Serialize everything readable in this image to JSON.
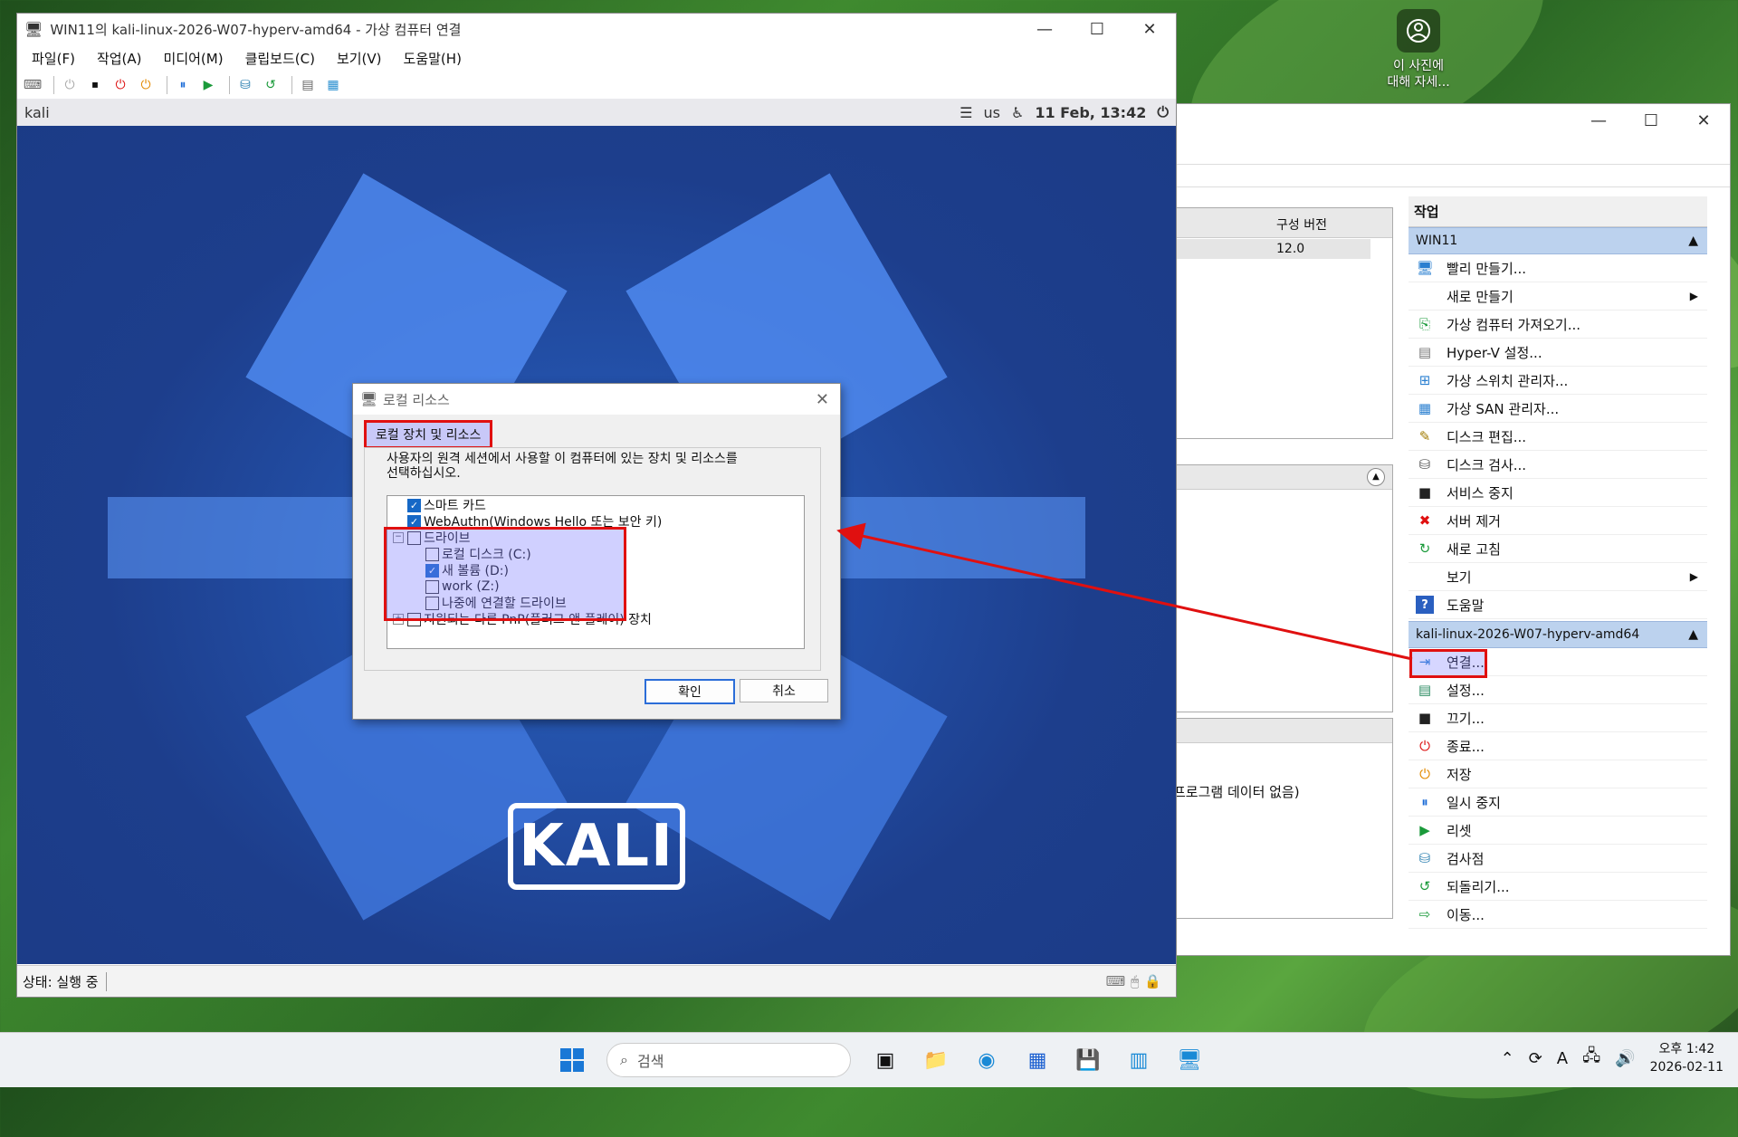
{
  "desktop": {
    "icon_label_line1": "이 사진에",
    "icon_label_line2": "대해 자세..."
  },
  "hyperv": {
    "col_header": "구성 버전",
    "col_value": "12.0",
    "no_data_text": "프로그램 데이터 없음)",
    "actions_title": "작업",
    "host_section": "WIN11",
    "host_items": [
      {
        "label": "빨리 만들기...",
        "icon": "quick-create-icon"
      },
      {
        "label": "새로 만들기",
        "icon": "none",
        "submenu": true
      },
      {
        "label": "가상 컴퓨터 가져오기...",
        "icon": "import-icon"
      },
      {
        "label": "Hyper-V 설정...",
        "icon": "settings-doc-icon"
      },
      {
        "label": "가상 스위치 관리자...",
        "icon": "switch-icon"
      },
      {
        "label": "가상 SAN 관리자...",
        "icon": "san-icon"
      },
      {
        "label": "디스크 편집...",
        "icon": "edit-disk-icon"
      },
      {
        "label": "디스크 검사...",
        "icon": "inspect-disk-icon"
      },
      {
        "label": "서비스 중지",
        "icon": "stop-service-icon"
      },
      {
        "label": "서버 제거",
        "icon": "remove-server-icon"
      },
      {
        "label": "새로 고침",
        "icon": "refresh-icon"
      },
      {
        "label": "보기",
        "icon": "none",
        "submenu": true
      },
      {
        "label": "도움말",
        "icon": "help-icon"
      }
    ],
    "vm_section": "kali-linux-2026-W07-hyperv-amd64",
    "vm_items": [
      {
        "label": "연결...",
        "icon": "connect-icon"
      },
      {
        "label": "설정...",
        "icon": "vm-settings-icon"
      },
      {
        "label": "끄기...",
        "icon": "turn-off-icon"
      },
      {
        "label": "종료...",
        "icon": "shutdown-icon"
      },
      {
        "label": "저장",
        "icon": "save-icon"
      },
      {
        "label": "일시 중지",
        "icon": "pause-icon"
      },
      {
        "label": "리셋",
        "icon": "reset-icon"
      },
      {
        "label": "검사점",
        "icon": "checkpoint-icon"
      },
      {
        "label": "되돌리기...",
        "icon": "revert-icon"
      },
      {
        "label": "이동...",
        "icon": "move-icon"
      }
    ]
  },
  "vmconnect": {
    "title": "WIN11의 kali-linux-2026-W07-hyperv-amd64 - 가상 컴퓨터 연결",
    "menu": [
      "파일(F)",
      "작업(A)",
      "미디어(M)",
      "클립보드(C)",
      "보기(V)",
      "도움말(H)"
    ],
    "status": "상태: 실행 중",
    "kali_host": "kali",
    "kali_lang": "us",
    "kali_clock": "11 Feb, 13:42",
    "kali_logo": "KALI"
  },
  "dialog": {
    "title": "로컬 리소스",
    "tab": "로컬 장치 및 리소스",
    "desc_line1": "사용자의 원격 세션에서 사용할 이 컴퓨터에 있는 장치 및 리소스를",
    "desc_line2": "선택하십시오.",
    "tree": {
      "smartcard": "스마트 카드",
      "webauthn": "WebAuthn(Windows Hello 또는 보안 키)",
      "drives": "드라이브",
      "drive_c": "로컬 디스크 (C:)",
      "drive_d": "새 볼륨 (D:)",
      "drive_z": "work (Z:)",
      "drive_later": "나중에 연결할 드라이브",
      "pnp": "지원되는 다른 PnP(플러그 앤 플레이) 장치"
    },
    "ok": "확인",
    "cancel": "취소"
  },
  "taskbar": {
    "search_placeholder": "검색",
    "time": "오후 1:42",
    "date": "2026-02-11",
    "ime": "A"
  }
}
